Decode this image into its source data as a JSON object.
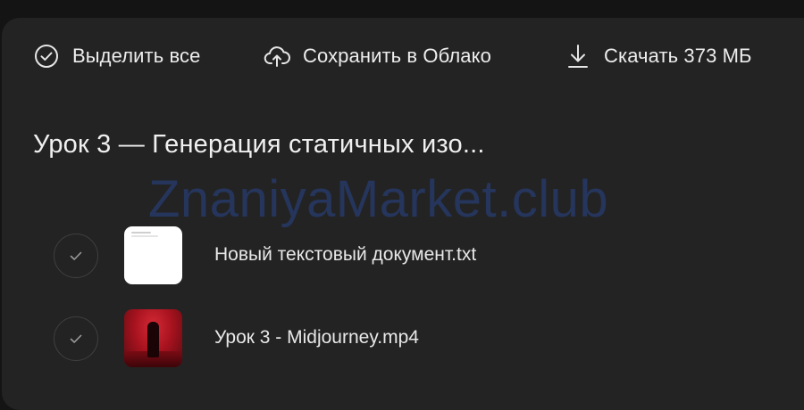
{
  "toolbar": {
    "select_all_label": "Выделить все",
    "save_cloud_label": "Сохранить в Облако",
    "download_label": "Скачать 373 МБ"
  },
  "folder": {
    "title": "Урок 3 — Генерация статичных изо..."
  },
  "watermark": "ZnaniyaMarket.club",
  "files": [
    {
      "name": "Новый текстовый документ.txt",
      "thumbnail": "text-document"
    },
    {
      "name": "Урок 3 - Midjourney.mp4",
      "thumbnail": "video-red-scene"
    }
  ],
  "colors": {
    "background": "#141414",
    "panel": "#232323",
    "text": "#ededed",
    "check_border": "#3f3f3f",
    "watermark": "#28468c"
  },
  "icons": {
    "select_all": "check-circle-icon",
    "save_cloud": "cloud-upload-icon",
    "download": "download-icon",
    "row_check": "check-icon"
  }
}
